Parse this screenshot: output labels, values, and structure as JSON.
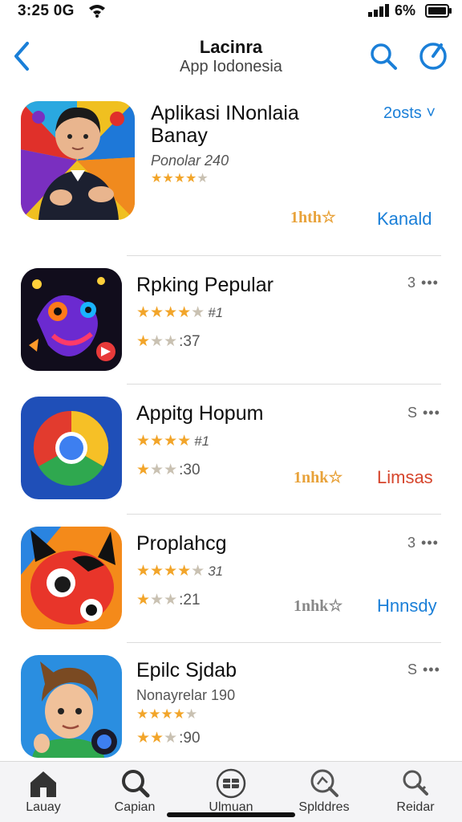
{
  "status_bar": {
    "time": "3:25 0G",
    "battery": "6%"
  },
  "header": {
    "title": "Lacinra",
    "subtitle": "App Iodonesia",
    "icons": [
      "back-chevron-icon",
      "search-icon",
      "compass-icon"
    ]
  },
  "featured": {
    "title_line1": "Aplikasi INonlaia",
    "title_line2": "Banay",
    "subtitle": "Ponolar 240",
    "get_label": "2osts ˅",
    "award": "1hth☆",
    "action": "Kanald"
  },
  "apps": [
    {
      "title": "Rpking Pepular",
      "rank": "#1",
      "count": ":37",
      "more": "3 •••",
      "award": "",
      "action": ""
    },
    {
      "title": "Appitg Hopum",
      "rank": "#1",
      "count": ":30",
      "more": "S •••",
      "award": "1nhk☆",
      "action": "Limsas"
    },
    {
      "title": "Proplahcg",
      "rank": "31",
      "count": ":21",
      "more": "3 •••",
      "award": "1nhk☆",
      "action": "Hnnsdy"
    },
    {
      "title": "Epilc Sjdab",
      "subtitle": "Nonayrelar 190",
      "count": ":90",
      "more": "S •••"
    }
  ],
  "tabs": [
    {
      "label": "Lauay",
      "icon": "home-icon"
    },
    {
      "label": "Capian",
      "icon": "search-icon"
    },
    {
      "label": "Ulmuan",
      "icon": "grid-icon"
    },
    {
      "label": "Splddres",
      "icon": "magnify-icon"
    },
    {
      "label": "Reidar",
      "icon": "key-search-icon"
    }
  ],
  "colors": {
    "accent": "#1a7fd8",
    "star": "#f2a52a",
    "award_orange": "#e8a23a",
    "action_red": "#d6452c"
  }
}
